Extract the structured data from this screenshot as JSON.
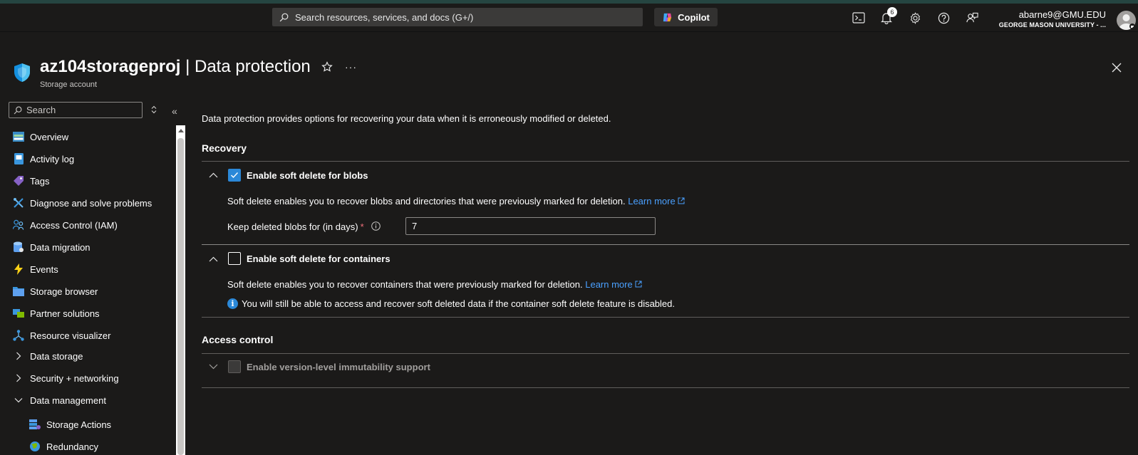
{
  "topbar": {
    "search_placeholder": "Search resources, services, and docs (G+/)",
    "copilot_label": "Copilot",
    "notification_count": "6",
    "user_email": "abarne9@GMU.EDU",
    "user_org": "GEORGE MASON UNIVERSITY - ..."
  },
  "header": {
    "resource_name": "az104storageproj",
    "separator": " | ",
    "page_name": "Data protection",
    "subtitle": "Storage account"
  },
  "sidebar": {
    "search_placeholder": "Search",
    "items": [
      {
        "label": "Overview",
        "icon": "overview-icon"
      },
      {
        "label": "Activity log",
        "icon": "activity-log-icon"
      },
      {
        "label": "Tags",
        "icon": "tag-icon"
      },
      {
        "label": "Diagnose and solve problems",
        "icon": "wrench-icon"
      },
      {
        "label": "Access Control (IAM)",
        "icon": "people-icon"
      },
      {
        "label": "Data migration",
        "icon": "database-icon"
      },
      {
        "label": "Events",
        "icon": "lightning-icon"
      },
      {
        "label": "Storage browser",
        "icon": "folder-icon"
      },
      {
        "label": "Partner solutions",
        "icon": "partner-icon"
      },
      {
        "label": "Resource visualizer",
        "icon": "network-icon"
      },
      {
        "label": "Data storage",
        "icon": "chevron-right-icon"
      },
      {
        "label": "Security + networking",
        "icon": "chevron-right-icon"
      },
      {
        "label": "Data management",
        "icon": "chevron-down-icon"
      },
      {
        "label": "Storage Actions",
        "icon": "storage-actions-icon"
      },
      {
        "label": "Redundancy",
        "icon": "globe-icon"
      }
    ]
  },
  "main": {
    "intro": "Data protection provides options for recovering your data when it is erroneously modified or deleted.",
    "recovery_heading": "Recovery",
    "blobs": {
      "label": "Enable soft delete for blobs",
      "checked": true,
      "description": "Soft delete enables you to recover blobs and directories that were previously marked for deletion.",
      "learn_more": "Learn more",
      "retention_label": "Keep deleted blobs for (in days)",
      "required_mark": "*",
      "retention_value": "7"
    },
    "containers": {
      "label": "Enable soft delete for containers",
      "checked": false,
      "description": "Soft delete enables you to recover containers that were previously marked for deletion.",
      "learn_more": "Learn more",
      "info_note": "You will still be able to access and recover soft deleted data if the container soft delete feature is disabled."
    },
    "access_heading": "Access control",
    "immutability": {
      "label": "Enable version-level immutability support",
      "checked": false,
      "disabled": true
    }
  },
  "colors": {
    "accent": "#2b88d8",
    "link": "#4aa0ff",
    "background": "#1b1a19"
  }
}
